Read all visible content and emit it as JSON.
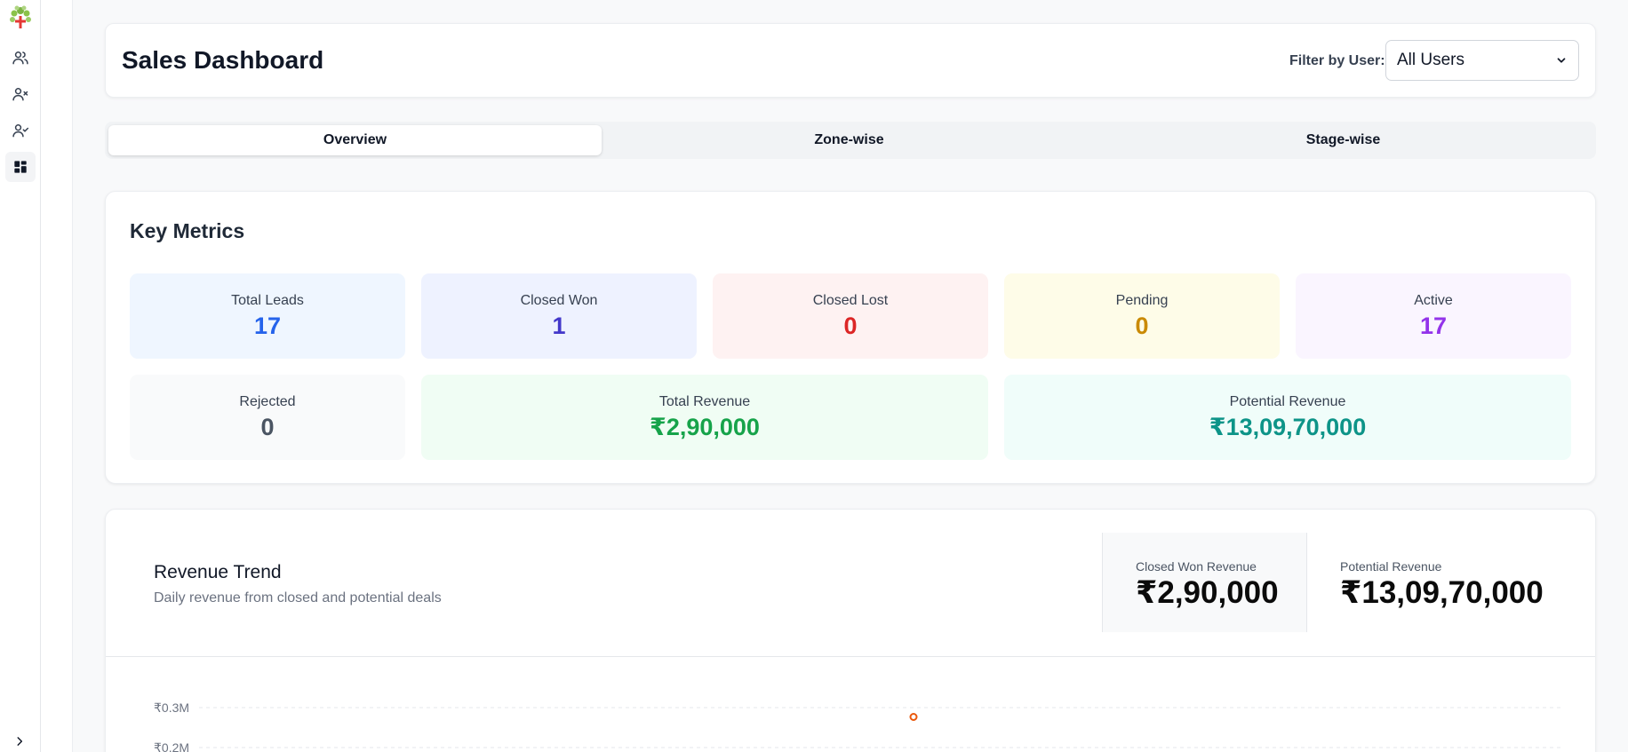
{
  "sidebar": {
    "items": [
      {
        "icon": "users-icon"
      },
      {
        "icon": "user-x-icon"
      },
      {
        "icon": "user-check-icon"
      },
      {
        "icon": "dashboard-icon"
      }
    ]
  },
  "header": {
    "title": "Sales Dashboard",
    "filter_label": "Filter by User:",
    "filter_value": "All Users"
  },
  "tabs": [
    {
      "label": "Overview",
      "active": true
    },
    {
      "label": "Zone-wise",
      "active": false
    },
    {
      "label": "Stage-wise",
      "active": false
    }
  ],
  "metrics": {
    "title": "Key Metrics",
    "items": [
      {
        "label": "Total Leads",
        "value": "17",
        "color": "#2563eb",
        "bg": "#eff6ff"
      },
      {
        "label": "Closed Won",
        "value": "1",
        "color": "#4338ca",
        "bg": "#eef2ff"
      },
      {
        "label": "Closed Lost",
        "value": "0",
        "color": "#dc2626",
        "bg": "#fef2f2"
      },
      {
        "label": "Pending",
        "value": "0",
        "color": "#ca8a04",
        "bg": "#fefce8"
      },
      {
        "label": "Active",
        "value": "17",
        "color": "#9333ea",
        "bg": "#faf5ff"
      },
      {
        "label": "Rejected",
        "value": "0",
        "color": "#4b5563",
        "bg": "#f9fafb"
      },
      {
        "label": "Total Revenue",
        "value": "₹2,90,000",
        "color": "#16a34a",
        "bg": "#f0fdf4"
      },
      {
        "label": "Potential Revenue",
        "value": "₹13,09,70,000",
        "color": "#0d9488",
        "bg": "#f0fdfa"
      }
    ]
  },
  "trend": {
    "title": "Revenue Trend",
    "subtitle": "Daily revenue from closed and potential deals",
    "closed_won_label": "Closed Won Revenue",
    "closed_won_value": "₹2,90,000",
    "potential_label": "Potential Revenue",
    "potential_value": "₹13,09,70,000"
  },
  "chart_data": {
    "type": "line",
    "y_ticks": [
      "₹0.3M",
      "₹0.2M"
    ],
    "series": [
      {
        "values": [
          290000
        ],
        "color": "#ea580c"
      }
    ]
  }
}
